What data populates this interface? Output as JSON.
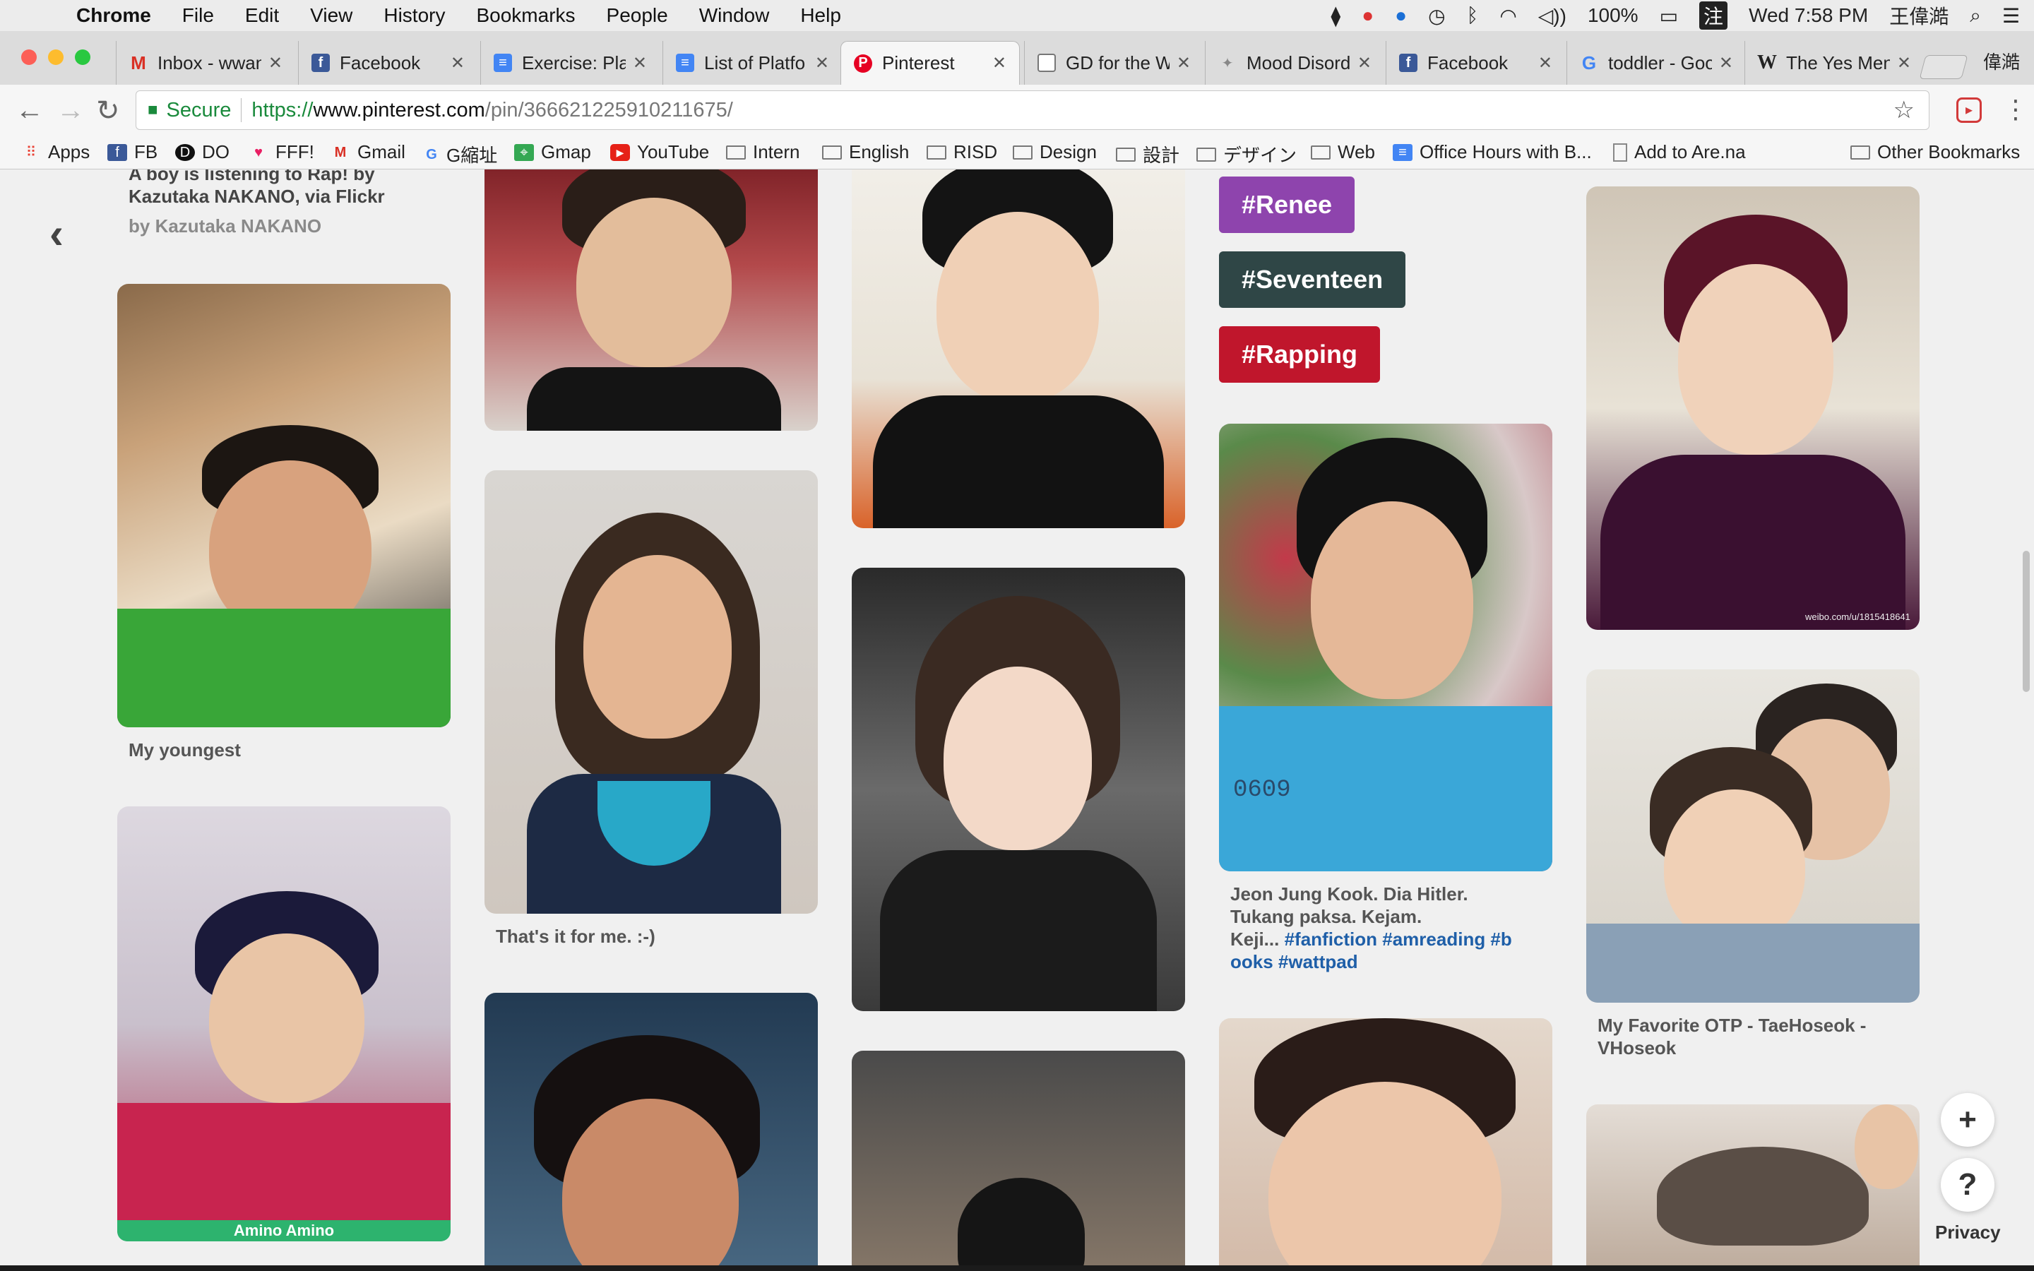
{
  "menubar": {
    "app": "Chrome",
    "items": [
      "File",
      "Edit",
      "View",
      "History",
      "Bookmarks",
      "People",
      "Window",
      "Help"
    ],
    "battery": "100%",
    "clock": "Wed 7:58 PM",
    "user": "王偉澔"
  },
  "tabs": [
    {
      "title": "Inbox - wwan",
      "icon": "gmail-icon"
    },
    {
      "title": "Facebook",
      "icon": "facebook-icon"
    },
    {
      "title": "Exercise: Pla",
      "icon": "docs-icon"
    },
    {
      "title": "List of Platfo",
      "icon": "docs-icon"
    },
    {
      "title": "Pinterest",
      "icon": "pinterest-icon"
    },
    {
      "title": "GD for the W",
      "icon": "document-icon"
    },
    {
      "title": "Mood Disord",
      "icon": "generic-site-icon"
    },
    {
      "title": "Facebook",
      "icon": "facebook-icon"
    },
    {
      "title": "toddler - Goo",
      "icon": "google-icon"
    },
    {
      "title": "The Yes Men",
      "icon": "wikipedia-icon"
    }
  ],
  "profile_name": "偉澔",
  "omnibox": {
    "secure_label": "Secure",
    "scheme": "https://",
    "host": "www.pinterest.com",
    "path": "/pin/366621225910211675/"
  },
  "bookmarks": [
    {
      "label": "Apps",
      "icon": "apps-grid-icon"
    },
    {
      "label": "FB",
      "icon": "facebook-icon"
    },
    {
      "label": "DO",
      "icon": "do-icon"
    },
    {
      "label": "FFF!",
      "icon": "heart-icon"
    },
    {
      "label": "Gmail",
      "icon": "gmail-icon"
    },
    {
      "label": "G縮址",
      "icon": "google-icon"
    },
    {
      "label": "Gmap",
      "icon": "maps-icon"
    },
    {
      "label": "YouTube",
      "icon": "youtube-icon"
    },
    {
      "label": "Intern",
      "icon": "folder-icon"
    },
    {
      "label": "English",
      "icon": "folder-icon"
    },
    {
      "label": "RISD",
      "icon": "folder-icon"
    },
    {
      "label": "Design",
      "icon": "folder-icon"
    },
    {
      "label": "設計",
      "icon": "folder-icon"
    },
    {
      "label": "デザイン",
      "icon": "folder-icon"
    },
    {
      "label": "Web",
      "icon": "folder-icon"
    },
    {
      "label": "Office Hours with B...",
      "icon": "docs-icon"
    },
    {
      "label": "Add to Are.na",
      "icon": "document-icon"
    }
  ],
  "other_bookmarks": "Other Bookmarks",
  "pins": {
    "top_caption_line1": "A boy is listening to Rap! by",
    "top_caption_line2": "Kazutaka NAKANO, via Flickr",
    "top_caption_by": "by Kazutaka NAKANO",
    "youngest": "My youngest",
    "thats_it": "That's it for me. :-)",
    "amino": "Amino Amino",
    "jjk_line1": "Jeon Jung Kook. Dia Hitler.",
    "jjk_line2": "Tukang paksa. Kejam.",
    "jjk_line3_prefix": "Keji...",
    "jjk_hash1": "#fanfiction #amreading #b",
    "jjk_hash2": "ooks #wattpad",
    "otp_line1": "My Favorite OTP - TaeHoseok -",
    "otp_line2": "VHoseok",
    "weibo_watermark": "weibo.com/u/1815418641",
    "photo_number": "0609"
  },
  "tags": [
    "#Renee",
    "#Seventeen",
    "#Rapping"
  ],
  "tag_colors": [
    "#8e44ad",
    "#2f4646",
    "#c0162c"
  ],
  "fab": {
    "add": "+",
    "help": "?",
    "privacy": "Privacy"
  }
}
